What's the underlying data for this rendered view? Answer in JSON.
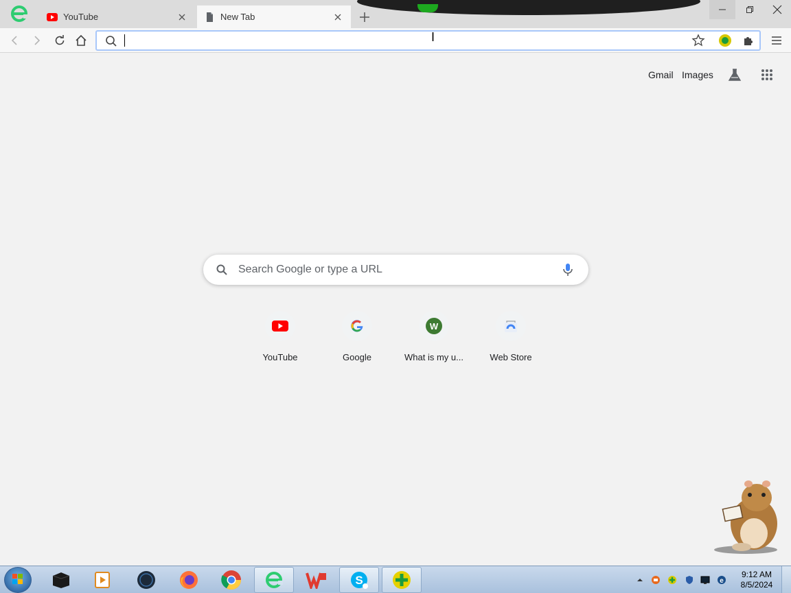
{
  "browser": {
    "tabs": [
      {
        "label": "YouTube",
        "icon": "youtube-icon",
        "active": false
      },
      {
        "label": "New Tab",
        "icon": "document-icon",
        "active": true
      }
    ],
    "omnibox": {
      "value": "",
      "placeholder": ""
    }
  },
  "ntp": {
    "top_links": {
      "gmail": "Gmail",
      "images": "Images"
    },
    "search_placeholder": "Search Google or type a URL",
    "shortcuts": [
      {
        "label": "YouTube",
        "icon": "youtube-icon"
      },
      {
        "label": "Google",
        "icon": "google-icon"
      },
      {
        "label": "What is my u...",
        "icon": "w-icon"
      },
      {
        "label": "Web Store",
        "icon": "web-store-icon"
      }
    ]
  },
  "taskbar": {
    "apps": [
      {
        "name": "black-box-app-icon"
      },
      {
        "name": "media-player-icon"
      },
      {
        "name": "dark-globe-icon"
      },
      {
        "name": "firefox-icon"
      },
      {
        "name": "chrome-icon"
      },
      {
        "name": "green-e-browser-icon"
      },
      {
        "name": "wps-office-icon"
      },
      {
        "name": "skype-icon"
      },
      {
        "name": "green-plus-icon"
      }
    ],
    "clock": {
      "time": "9:12 AM",
      "date": "8/5/2024"
    }
  },
  "colors": {
    "accent": "#1a73e8",
    "youtube_red": "#ff0000",
    "green_e": "#2ecc71"
  }
}
